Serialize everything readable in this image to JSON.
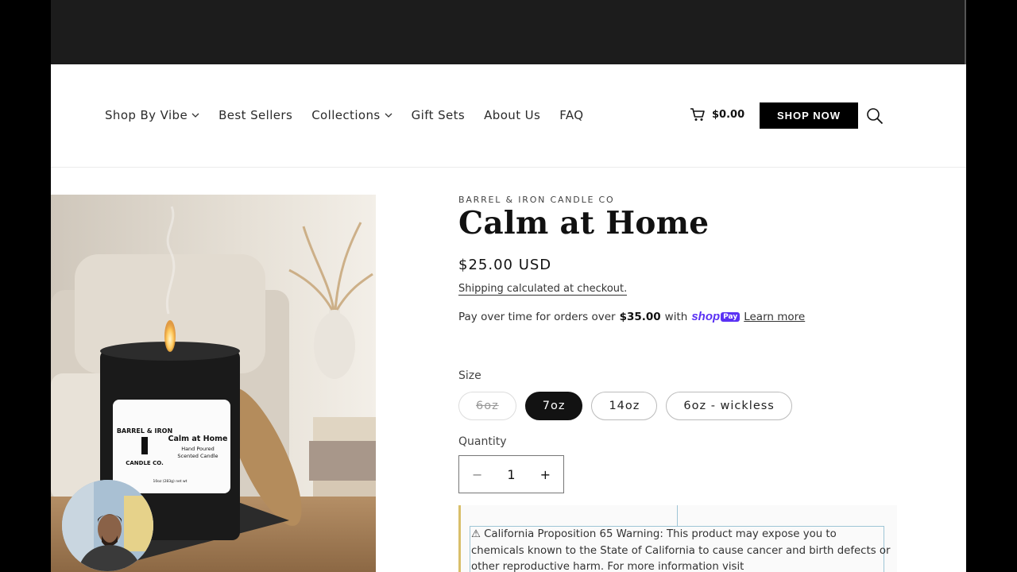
{
  "nav": {
    "items": [
      {
        "label": "Shop By Vibe",
        "dropdown": true
      },
      {
        "label": "Best Sellers",
        "dropdown": false
      },
      {
        "label": "Collections",
        "dropdown": true
      },
      {
        "label": "Gift Sets",
        "dropdown": false
      },
      {
        "label": "About Us",
        "dropdown": false
      },
      {
        "label": "FAQ",
        "dropdown": false
      }
    ]
  },
  "header": {
    "cart_total": "$0.00",
    "shop_now_label": "SHOP NOW"
  },
  "product": {
    "vendor": "BARREL & IRON CANDLE CO",
    "title": "Calm at Home",
    "price": "$25.00 USD",
    "shipping_link": "Shipping",
    "shipping_rest": " calculated at checkout.",
    "payover_prefix": "Pay over time for orders over",
    "payover_amount": "$35.00",
    "payover_with": "with",
    "shoppay_shop": "shop",
    "shoppay_pay": "Pay",
    "learn_more": "Learn more",
    "size_label": "Size",
    "sizes": [
      {
        "label": "6oz",
        "state": "disabled"
      },
      {
        "label": "7oz",
        "state": "selected"
      },
      {
        "label": "14oz",
        "state": "available"
      },
      {
        "label": "6oz - wickless",
        "state": "available"
      }
    ],
    "quantity_label": "Quantity",
    "quantity": "1",
    "minus": "−",
    "plus": "+",
    "warning": "⚠ California Proposition 65 Warning: This product may expose you to chemicals known to the State of California to cause cancer and birth defects or other reproductive harm. For more information visit"
  },
  "label_art": {
    "brand_arc": "BARREL & IRON",
    "brand_arc2": "CANDLE CO.",
    "name": "Calm at Home",
    "line1": "Hand Poured",
    "line2": "Scented Candle",
    "weight": "10oz (283g) net wt"
  },
  "colors": {
    "accent": "#121212",
    "shoppay": "#5a31f4",
    "warning_border": "#d9bf6a"
  }
}
